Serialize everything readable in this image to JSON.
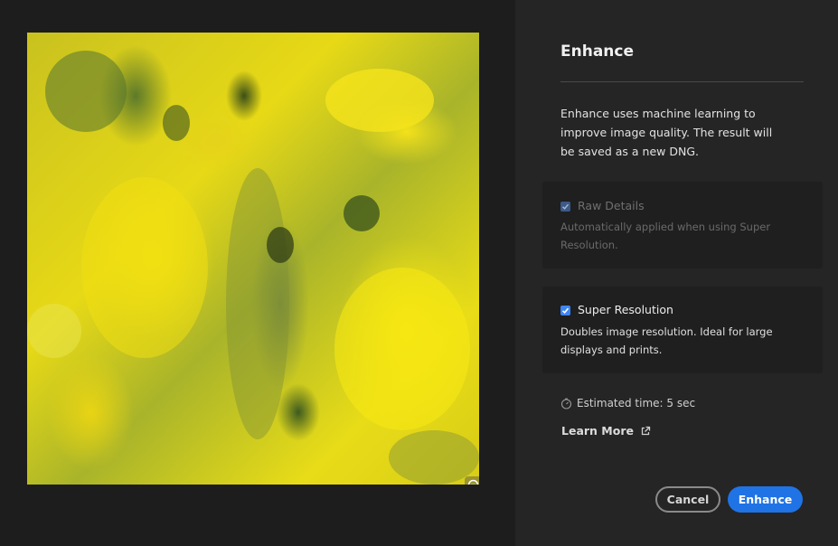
{
  "dialog": {
    "title": "Enhance",
    "description": "Enhance uses machine learning to improve image quality. The result will be saved as a new DNG."
  },
  "options": {
    "raw_details": {
      "label": "Raw Details",
      "description": "Automatically applied when using Super Resolution.",
      "checked": true,
      "enabled": false
    },
    "super_resolution": {
      "label": "Super Resolution",
      "description": "Doubles image resolution. Ideal for large displays and prints.",
      "checked": true,
      "enabled": true
    }
  },
  "estimate": {
    "text": "Estimated time: 5 sec",
    "icon": "stopwatch-icon"
  },
  "learn_more": {
    "label": "Learn More",
    "icon": "external-link-icon"
  },
  "buttons": {
    "cancel": "Cancel",
    "enhance": "Enhance"
  },
  "preview": {
    "zoom_icon": "zoom-out-icon"
  },
  "colors": {
    "accent": "#1f73e5",
    "panel_bg": "#252525",
    "preview_bg": "#1d1d1d"
  }
}
